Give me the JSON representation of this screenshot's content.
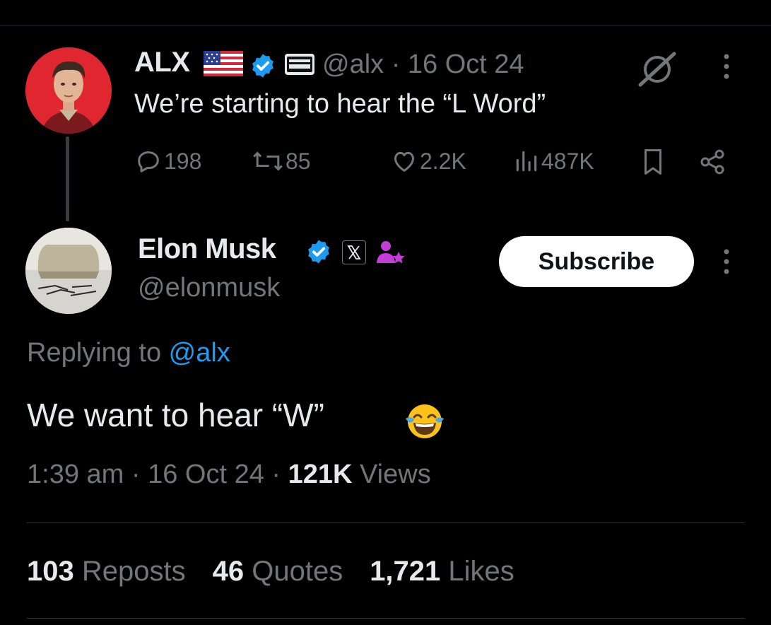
{
  "parent_tweet": {
    "name": "ALX",
    "handle_date": "@alx · 16 Oct 24",
    "text": "We’re starting to hear the “L Word”",
    "replies": "198",
    "reposts": "85",
    "likes": "2.2K",
    "views": "487K",
    "icons": [
      "us-flag-icon",
      "verified-badge-icon",
      "affiliate-badge-icon",
      "grok-icon",
      "more-icon",
      "reply-icon",
      "repost-icon",
      "like-icon",
      "views-icon",
      "bookmark-icon",
      "share-icon"
    ]
  },
  "reply_tweet": {
    "name": "Elon Musk",
    "handle": "@elonmusk",
    "subscribe_label": "Subscribe",
    "replying_prefix": "Replying to ",
    "replying_mention": "@alx",
    "text": "We want to hear “W”",
    "time_date": "1:39 am · 16 Oct 24 · ",
    "views_count": "121K",
    "views_label": " Views",
    "icons": [
      "verified-badge-icon",
      "x-badge-icon",
      "affiliate-icon",
      "more-icon",
      "tears-of-joy-emoji"
    ]
  },
  "stats": {
    "reposts_count": "103",
    "reposts_label": " Reposts",
    "quotes_count": "46",
    "quotes_label": " Quotes",
    "likes_count": "1,721",
    "likes_label": " Likes"
  },
  "colors": {
    "background": "#000000",
    "text": "#e7e9ea",
    "secondary": "#71767b",
    "accent": "#1d9bf0",
    "avatar_alx": "#e0262f"
  }
}
